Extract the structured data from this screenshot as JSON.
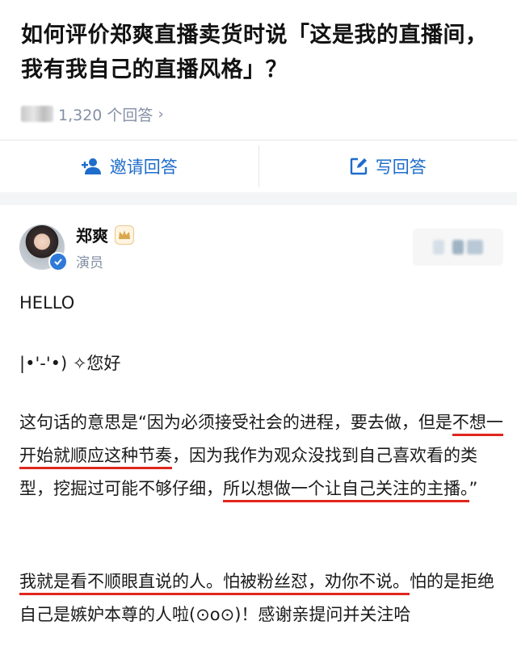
{
  "question": {
    "title": "如何评价郑爽直播卖货时说「这是我的直播间，我有我自己的直播风格」？",
    "answer_count": "1,320 个回答",
    "chevron": "›"
  },
  "actions": {
    "invite_label": "邀请回答",
    "write_label": "写回答",
    "invite_icon": "add-user-icon",
    "write_icon": "edit-icon",
    "accent_color": "#1e6ccb"
  },
  "author": {
    "name": "郑爽",
    "role": "演员",
    "badge_icon": "crown-icon",
    "verified_icon": "verified-check-icon"
  },
  "answer": {
    "p1": "HELLO",
    "p2": "|•'-'•) ✧您好",
    "p3_parts": {
      "a": "这句话的意思是“因为必须接受社会的进程，要去做，但是",
      "b": "不想一开始就顺应这种节奏",
      "c": "，因为我作为观众没找到自己喜欢看的类型，挖掘过可能不够仔细，",
      "d": "所以想做一个让自己关注的主播。",
      "e": "”"
    },
    "p4_parts": {
      "a": "我就是看不顺眼直说的人。怕被粉丝怼，劝你不说。",
      "b": "怕的是拒绝自己是嫉妒本尊的人啦(⊙o⊙)！感谢亲提问并关注哈"
    },
    "underline_color": "#e0261d"
  }
}
